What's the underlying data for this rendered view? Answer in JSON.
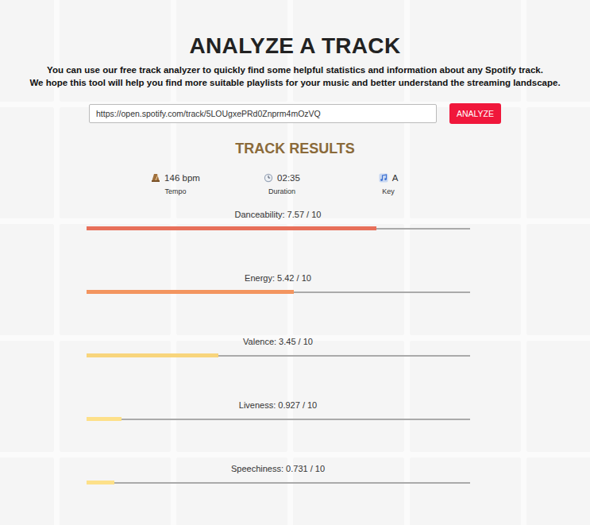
{
  "title": "ANALYZE A TRACK",
  "intro": [
    "You can use our free track analyzer to quickly find some helpful statistics and information about any Spotify track.",
    "We hope this tool will help you find more suitable playlists for your music and better understand the streaming landscape."
  ],
  "search": {
    "value": "https://open.spotify.com/track/5LOUgxePRd0Znprm4mOzVQ",
    "button": "ANALYZE"
  },
  "results": {
    "heading": "TRACK RESULTS",
    "stats": [
      {
        "value": "146 bpm",
        "label": "Tempo"
      },
      {
        "value": "02:35",
        "label": "Duration"
      },
      {
        "value": "A",
        "label": "Key"
      }
    ],
    "meters": [
      {
        "label": "Danceability: 7.57 / 10",
        "level": 0.757,
        "color": "#e8705a"
      },
      {
        "label": "Energy: 5.42 / 10",
        "level": 0.542,
        "color": "#f3955f"
      },
      {
        "label": "Valence: 3.45 / 10",
        "level": 0.345,
        "color": "#f8d57c"
      },
      {
        "label": "Liveness: 0.927 / 10",
        "level": 0.0927,
        "color": "#fde089"
      },
      {
        "label": "Speechiness: 0.731 / 10",
        "level": 0.0731,
        "color": "#fde089"
      }
    ]
  }
}
